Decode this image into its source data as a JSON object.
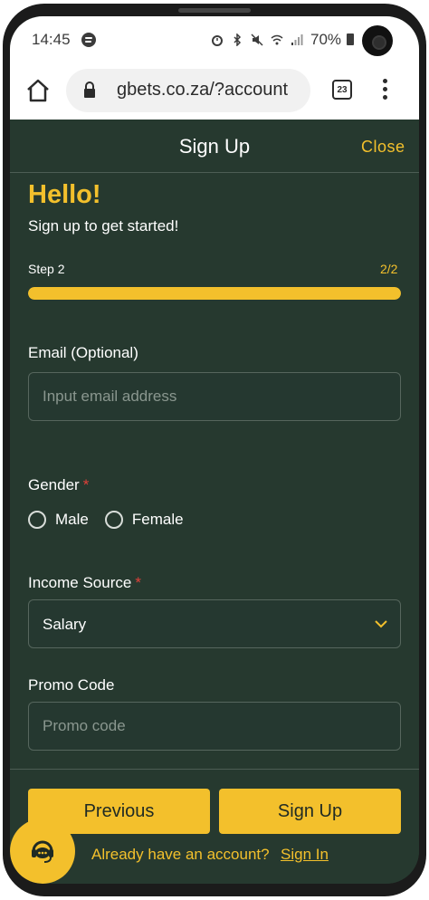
{
  "statusbar": {
    "time": "14:45",
    "battery": "70%",
    "icons": [
      "spotify-icon",
      "alarm-icon",
      "bluetooth-icon",
      "mute-icon",
      "wifi-icon",
      "signal-icon",
      "battery-icon"
    ]
  },
  "browser": {
    "url": "gbets.co.za/?account",
    "tab_count": "23"
  },
  "modal": {
    "title": "Sign Up",
    "close_label": "Close"
  },
  "intro": {
    "heading": "Hello!",
    "subheading": "Sign up to get started!"
  },
  "progress": {
    "step_label": "Step 2",
    "step_count": "2/2",
    "value": 1.0
  },
  "form": {
    "email": {
      "label": "Email (Optional)",
      "placeholder": "Input email address",
      "value": ""
    },
    "gender": {
      "label": "Gender",
      "required_mark": "*",
      "options": [
        "Male",
        "Female"
      ],
      "selected": null
    },
    "income_source": {
      "label": "Income Source",
      "required_mark": "*",
      "selected_value": "Salary"
    },
    "promo": {
      "label": "Promo Code",
      "placeholder": "Promo code",
      "value": ""
    }
  },
  "actions": {
    "previous_label": "Previous",
    "signup_label": "Sign Up",
    "already_text": "Already have an account?",
    "signin_label": "Sign In"
  },
  "colors": {
    "accent": "#f3c02c",
    "background": "#26392f",
    "required": "#e0413a"
  }
}
